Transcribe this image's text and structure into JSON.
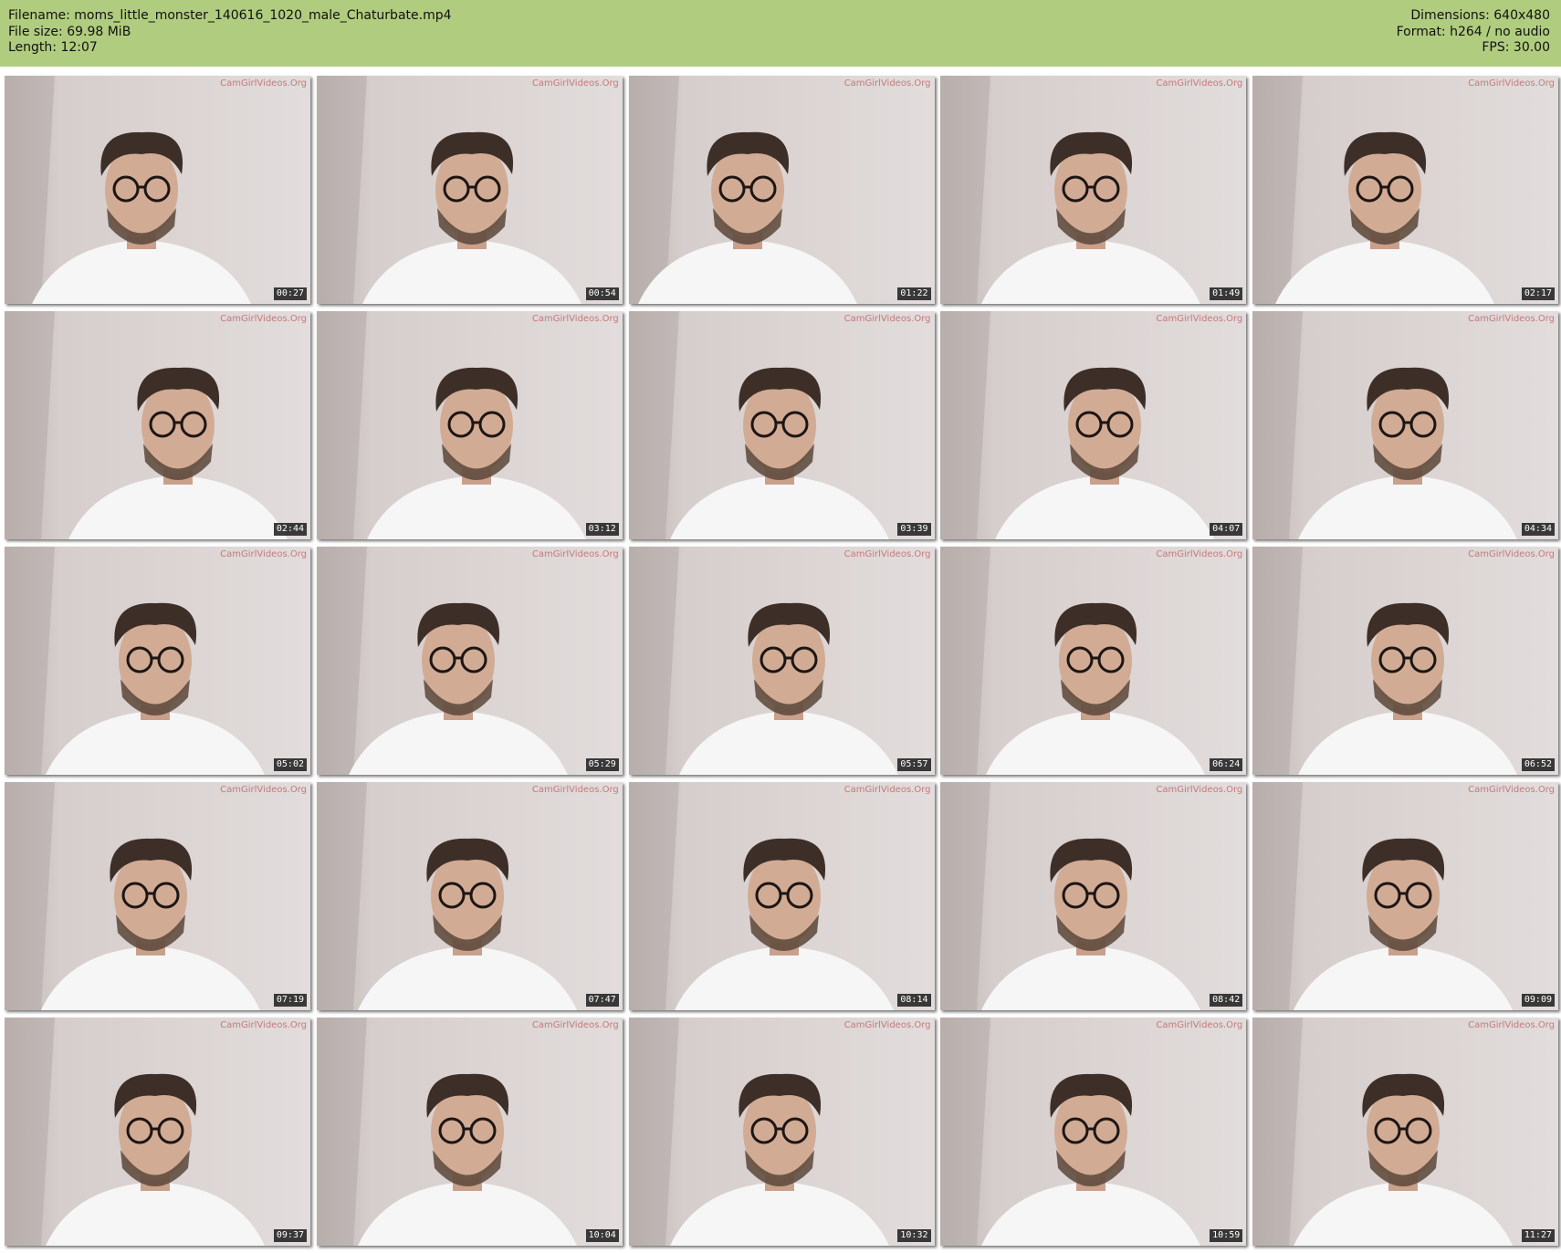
{
  "meta": {
    "filename": "Filename: moms_little_monster_140616_1020_male_Chaturbate.mp4",
    "file_size": "File size: 69.98 MiB",
    "length": "Length: 12:07",
    "dimensions": "Dimensions: 640x480",
    "format": "Format: h264 / no audio",
    "fps": "FPS: 30.00"
  },
  "watermark": "CamGirlVideos.Org",
  "frames": [
    {
      "time": "00:27"
    },
    {
      "time": "00:54"
    },
    {
      "time": "01:22"
    },
    {
      "time": "01:49"
    },
    {
      "time": "02:17"
    },
    {
      "time": "02:44"
    },
    {
      "time": "03:12"
    },
    {
      "time": "03:39"
    },
    {
      "time": "04:07"
    },
    {
      "time": "04:34"
    },
    {
      "time": "05:02"
    },
    {
      "time": "05:29"
    },
    {
      "time": "05:57"
    },
    {
      "time": "06:24"
    },
    {
      "time": "06:52"
    },
    {
      "time": "07:19"
    },
    {
      "time": "07:47"
    },
    {
      "time": "08:14"
    },
    {
      "time": "08:42"
    },
    {
      "time": "09:09"
    },
    {
      "time": "09:37"
    },
    {
      "time": "10:04"
    },
    {
      "time": "10:32"
    },
    {
      "time": "10:59"
    },
    {
      "time": "11:27"
    }
  ]
}
